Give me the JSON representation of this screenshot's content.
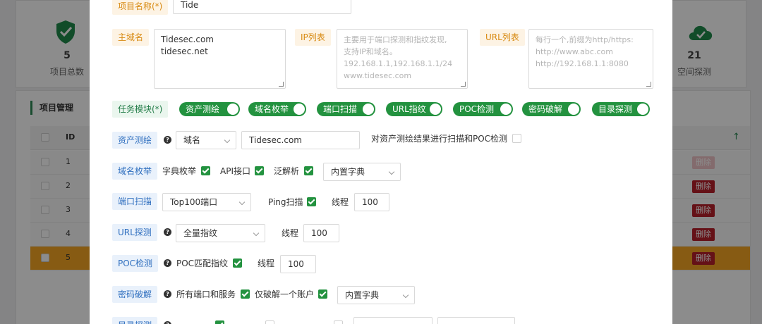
{
  "background": {
    "stats_left": {
      "value": "5",
      "label": "项目总数",
      "icon": "shield-check-icon"
    },
    "stats_right": {
      "value": "21",
      "label": "空间探测",
      "icon": "cloud-icon"
    },
    "panel_title": "项目管理",
    "table": {
      "header_id": "ID",
      "rows": [
        {
          "id": "1",
          "delete_label": "删除"
        },
        {
          "id": "2",
          "delete_label": "删除"
        },
        {
          "id": "3",
          "delete_label": "删除"
        },
        {
          "id": "4",
          "delete_label": "删除"
        },
        {
          "id": "5",
          "delete_label": "删除"
        }
      ]
    }
  },
  "form": {
    "project_name": {
      "label": "项目名称(*)",
      "value": "Tide"
    },
    "main_domain": {
      "label": "主域名",
      "lines": [
        "Tidesec.com",
        "tidesec.net"
      ]
    },
    "ip_list": {
      "label": "IP列表",
      "placeholder_lines": [
        "主要用于端口探测和指纹发现,",
        "支持IP和域名。",
        "192.168.1.1,192.168.1.1/24",
        "www.tidesec.com"
      ]
    },
    "url_list": {
      "label": "URL列表",
      "placeholder_lines": [
        "每行一个,前缀为http/https:",
        "http://www.abc.com",
        "http://192.168.1.1:8080"
      ]
    },
    "task_modules": {
      "label": "任务模块(*)",
      "toggles": [
        "资产测绘",
        "域名枚举",
        "端口扫描",
        "URL指纹",
        "POC检测",
        "密码破解",
        "目录探测"
      ]
    },
    "asset_mapping": {
      "label": "资产测绘",
      "type_value": "域名",
      "query_value": "Tidesec.com",
      "scan_poc_text": "对资产测绘结果进行扫描和POC检测"
    },
    "domain_enum": {
      "label": "域名枚举",
      "opt1": "字典枚举",
      "opt2": "API接口",
      "opt3": "泛解析",
      "dict_value": "内置字典"
    },
    "port_scan": {
      "label": "端口扫描",
      "ports_value": "Top100端口",
      "ping_text": "Ping扫描",
      "threads_text": "线程",
      "threads_value": "100"
    },
    "url_probe": {
      "label": "URL探测",
      "fp_value": "全量指纹",
      "threads_text": "线程",
      "threads_value": "100"
    },
    "poc_check": {
      "label": "POC检测",
      "match_text": "POC匹配指纹",
      "threads_text": "线程",
      "threads_value": "100"
    },
    "password_crack": {
      "label": "密码破解",
      "opt1": "所有端口和服务",
      "opt2": "仅破解一个账户",
      "dict_value": "内置字典"
    },
    "dir_probe": {
      "label": "目录探测"
    }
  },
  "colors": {
    "accent_green": "#23923f",
    "delete_red": "#b8202a",
    "row_highlight": "#f6a623"
  }
}
